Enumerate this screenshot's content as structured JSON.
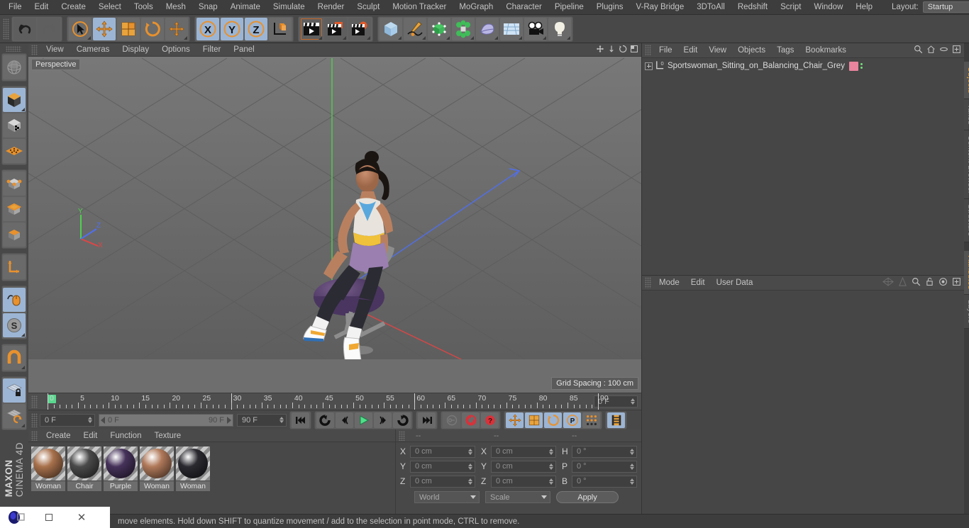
{
  "app": {
    "name": "MAXON",
    "product": "CINEMA 4D"
  },
  "menubar": {
    "items": [
      "File",
      "Edit",
      "Create",
      "Select",
      "Tools",
      "Mesh",
      "Snap",
      "Animate",
      "Simulate",
      "Render",
      "Sculpt",
      "Motion Tracker",
      "MoGraph",
      "Character",
      "Pipeline",
      "Plugins",
      "V-Ray Bridge",
      "3DToAll",
      "Redshift",
      "Script",
      "Window",
      "Help"
    ],
    "layout_label": "Layout:",
    "layout_value": "Startup",
    "right_icons": [
      "search-icon",
      "home-icon",
      "minimize-icon",
      "maximize-icon"
    ]
  },
  "toolbar": {
    "groups": [
      {
        "name": "history",
        "buttons": [
          {
            "name": "undo-button",
            "icon": "undo-arrow",
            "state": "normal"
          },
          {
            "name": "redo-button",
            "icon": "redo-arrow",
            "state": "disabled"
          }
        ]
      },
      {
        "name": "transform",
        "buttons": [
          {
            "name": "live-selection-button",
            "icon": "cursor-circle",
            "state": "normal"
          },
          {
            "name": "move-button",
            "icon": "move-cross",
            "state": "selected"
          },
          {
            "name": "scale-button",
            "icon": "scale-box",
            "state": "normal"
          },
          {
            "name": "rotate-button",
            "icon": "rotate-arc",
            "state": "normal"
          },
          {
            "name": "dynamic-place-button",
            "icon": "move-cross-small",
            "state": "normal"
          }
        ]
      },
      {
        "name": "axis-locks",
        "buttons": [
          {
            "name": "x-axis-button",
            "icon": "x-axis",
            "state": "selected",
            "label": "X"
          },
          {
            "name": "y-axis-button",
            "icon": "y-axis",
            "state": "selected",
            "label": "Y"
          },
          {
            "name": "z-axis-button",
            "icon": "z-axis",
            "state": "selected",
            "label": "Z"
          },
          {
            "name": "world-object-axis-button",
            "icon": "world-axis-cube",
            "state": "normal"
          }
        ]
      },
      {
        "name": "render",
        "buttons": [
          {
            "name": "render-view-button",
            "icon": "clapper-view",
            "state": "normal"
          },
          {
            "name": "render-to-picture-viewer-button",
            "icon": "clapper-picture",
            "state": "normal"
          },
          {
            "name": "render-settings-button",
            "icon": "clapper-gear",
            "state": "normal"
          }
        ]
      },
      {
        "name": "create",
        "buttons": [
          {
            "name": "add-cube-button",
            "icon": "cube-blue",
            "state": "normal"
          },
          {
            "name": "add-spline-button",
            "icon": "pen-spline",
            "state": "normal"
          },
          {
            "name": "add-generator-button",
            "icon": "green-cube-cage",
            "state": "normal"
          },
          {
            "name": "add-array-button",
            "icon": "green-cluster",
            "state": "normal"
          },
          {
            "name": "add-deformer-button",
            "icon": "bend-deformer",
            "state": "normal"
          },
          {
            "name": "add-scene-object-button",
            "icon": "floor-grid",
            "state": "normal"
          },
          {
            "name": "add-camera-button",
            "icon": "camera",
            "state": "normal"
          },
          {
            "name": "add-light-button",
            "icon": "light-bulb",
            "state": "normal"
          }
        ]
      }
    ]
  },
  "left_toolbar": {
    "buttons": [
      {
        "name": "make-editable-button",
        "icon": "globe-wire",
        "state": "normal"
      },
      {
        "name": "model-mode-button",
        "icon": "cube-dark",
        "state": "selected"
      },
      {
        "name": "texture-mode-button",
        "icon": "cube-checker",
        "state": "normal"
      },
      {
        "name": "polygon-grid-button",
        "icon": "orange-mesh-plane",
        "state": "normal"
      },
      {
        "name": "point-mode-button",
        "icon": "cube-points",
        "state": "normal"
      },
      {
        "name": "edge-mode-button",
        "icon": "cube-edges",
        "state": "normal"
      },
      {
        "name": "polygon-mode-button",
        "icon": "cube-polygon",
        "state": "normal"
      },
      {
        "name": "axis-mode-button",
        "icon": "orange-axis-l",
        "state": "normal"
      },
      {
        "name": "enable-snap-button",
        "icon": "mouse-spline",
        "state": "selected"
      },
      {
        "name": "soft-selection-button",
        "icon": "s-sphere",
        "state": "selected"
      },
      {
        "name": "magnet-button",
        "icon": "magnet",
        "state": "normal"
      },
      {
        "name": "workplane-lock-button",
        "icon": "grid-lock",
        "state": "selected"
      },
      {
        "name": "workplane-rotate-button",
        "icon": "grid-rotate",
        "state": "normal"
      }
    ]
  },
  "viewport": {
    "menu": [
      "View",
      "Cameras",
      "Display",
      "Options",
      "Filter",
      "Panel"
    ],
    "header_icons": [
      "pan-icon",
      "zoom-icon",
      "rotate-icon",
      "maximize-icon"
    ],
    "view_label": "Perspective",
    "grid_spacing": "Grid Spacing : 100 cm",
    "axis_gizmo": {
      "x": "X",
      "y": "Y",
      "z": "Z",
      "x_color": "#e04545",
      "y_color": "#4fd14f",
      "z_color": "#4f6ff0"
    },
    "scene_description": "Sportswoman sitting on a purple balancing chair"
  },
  "timeline": {
    "ticks": [
      0,
      5,
      10,
      15,
      20,
      25,
      30,
      35,
      40,
      45,
      50,
      55,
      60,
      65,
      70,
      75,
      80,
      85,
      90
    ],
    "current_frame_field": "0 F",
    "marker_frame": 0
  },
  "transport": {
    "start_field": "0 F",
    "range_start": "0 F",
    "range_end": "90 F",
    "end_field": "90 F",
    "buttons": [
      {
        "name": "go-to-start-button",
        "icon": "skip-back",
        "state": "normal"
      },
      {
        "name": "previous-keyframe-button",
        "icon": "loop-back",
        "state": "normal"
      },
      {
        "name": "previous-frame-button",
        "icon": "step-back",
        "state": "normal"
      },
      {
        "name": "play-button",
        "icon": "play-triangle",
        "state": "normal"
      },
      {
        "name": "next-frame-button",
        "icon": "step-forward",
        "state": "normal"
      },
      {
        "name": "next-keyframe-button",
        "icon": "loop-forward",
        "state": "normal"
      },
      {
        "name": "go-to-end-button",
        "icon": "skip-forward",
        "state": "normal"
      },
      {
        "name": "record-active-objects-button",
        "icon": "key-grey",
        "state": "disabled"
      },
      {
        "name": "autokeying-button",
        "icon": "record-red",
        "state": "normal"
      },
      {
        "name": "keyframe-selection-button",
        "icon": "question-red",
        "state": "normal"
      },
      {
        "name": "position-key-button",
        "icon": "move-cross",
        "state": "selected"
      },
      {
        "name": "scale-key-button",
        "icon": "scale-box",
        "state": "selected"
      },
      {
        "name": "rotation-key-button",
        "icon": "rotate-arc",
        "state": "selected"
      },
      {
        "name": "parameter-key-button",
        "icon": "p-circle",
        "state": "selected"
      },
      {
        "name": "point-level-animation-button",
        "icon": "dot-matrix",
        "state": "normal"
      },
      {
        "name": "timeline-filmstrip-button",
        "icon": "film-strip",
        "state": "selected"
      }
    ]
  },
  "material_manager": {
    "menu": [
      "Create",
      "Edit",
      "Function",
      "Texture"
    ],
    "materials": [
      {
        "name": "Woman",
        "color": "#a8714c"
      },
      {
        "name": "Chair",
        "color": "#4a4a4a"
      },
      {
        "name": "Purple",
        "color": "#46325a"
      },
      {
        "name": "Woman",
        "color": "#b0795a"
      },
      {
        "name": "Woman",
        "color": "#2a2a30"
      }
    ]
  },
  "coordinates": {
    "placeholders": [
      "--",
      "--",
      "--"
    ],
    "position": {
      "label_x": "X",
      "label_y": "Y",
      "label_z": "Z",
      "x": "0 cm",
      "y": "0 cm",
      "z": "0 cm"
    },
    "size": {
      "label_x": "X",
      "label_y": "Y",
      "label_z": "Z",
      "x": "0 cm",
      "y": "0 cm",
      "z": "0 cm"
    },
    "rotation": {
      "label_h": "H",
      "label_p": "P",
      "label_b": "B",
      "h": "0 °",
      "p": "0 °",
      "b": "0 °"
    },
    "coordinate_system": "World",
    "size_mode": "Scale",
    "apply_label": "Apply"
  },
  "object_manager": {
    "menu": [
      "File",
      "Edit",
      "View",
      "Objects",
      "Tags",
      "Bookmarks"
    ],
    "header_icons": [
      "search-icon",
      "home-icon",
      "eye-icon",
      "plus-box-icon"
    ],
    "objects": [
      {
        "name": "Sportswoman_Sitting_on_Balancing_Chair_Grey",
        "tag_color": "#e8849d",
        "layer_dots": "#6fe07a"
      }
    ]
  },
  "attribute_manager": {
    "menu": [
      "Mode",
      "Edit",
      "User Data"
    ],
    "header_icons": [
      "pyramid-icon",
      "cone-icon",
      "search-icon",
      "lock-icon",
      "target-icon",
      "plus-box-icon"
    ]
  },
  "right_tabs": {
    "top": [
      {
        "label": "Objects",
        "active": true
      },
      {
        "label": "Takes",
        "active": false
      },
      {
        "label": "Content Browser",
        "active": false
      },
      {
        "label": "Structure",
        "active": false
      }
    ],
    "bottom": [
      {
        "label": "Attributes",
        "active": true
      },
      {
        "label": "Layers",
        "active": false
      }
    ]
  },
  "statusbar": {
    "text": "move elements. Hold down SHIFT to quantize movement / add to the selection in point mode, CTRL to remove."
  },
  "window_controls": {
    "buttons": [
      "app-logo",
      "restore-icon",
      "maximize-icon",
      "close-icon"
    ]
  },
  "colors": {
    "accent_orange": "#e8912d",
    "selected_blue": "#9cb5d4",
    "panel_bg": "#464646",
    "toolbar_bg": "#484848",
    "viewport_bg": "#6e6e6e"
  }
}
